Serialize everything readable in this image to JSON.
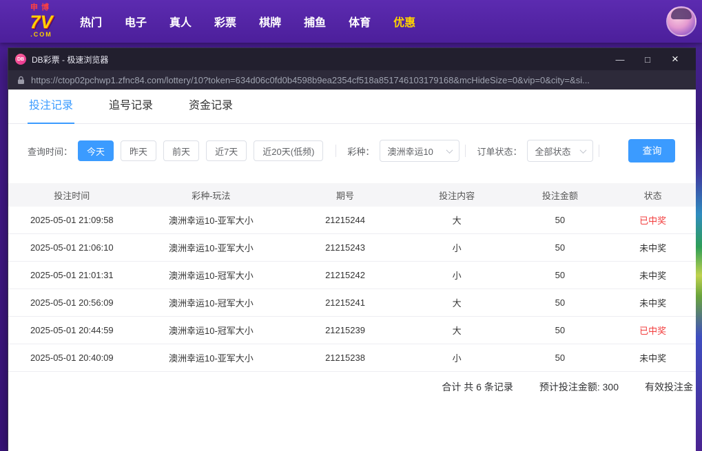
{
  "topbar": {
    "logo": {
      "line1": "申博",
      "line2": "7V",
      "line3": ".COM"
    },
    "nav": [
      {
        "label": "热门"
      },
      {
        "label": "电子"
      },
      {
        "label": "真人"
      },
      {
        "label": "彩票"
      },
      {
        "label": "棋牌"
      },
      {
        "label": "捕鱼"
      },
      {
        "label": "体育"
      },
      {
        "label": "优惠",
        "highlight": true
      }
    ]
  },
  "browser": {
    "badge": "DB",
    "title": "DB彩票 - 极速浏览器",
    "url": "https://ctop02pchwp1.zfnc84.com/lottery/10?token=634d06c0fd0b4598b9ea2354cf518a851746103179168&mcHideSize=0&vip=0&city=&si...",
    "controls": {
      "minimize": "—",
      "maximize": "□",
      "close": "×"
    }
  },
  "tabs": [
    {
      "label": "投注记录",
      "active": true
    },
    {
      "label": "追号记录"
    },
    {
      "label": "资金记录"
    }
  ],
  "filters": {
    "time_label": "查询时间：",
    "time_options": [
      {
        "label": "今天",
        "active": true
      },
      {
        "label": "昨天"
      },
      {
        "label": "前天"
      },
      {
        "label": "近7天"
      },
      {
        "label": "近20天(低频)"
      }
    ],
    "lottery_label": "彩种：",
    "lottery_value": "澳洲幸运10",
    "status_label": "订单状态：",
    "status_value": "全部状态",
    "search_button": "查询"
  },
  "table": {
    "headers": [
      "投注时间",
      "彩种-玩法",
      "期号",
      "投注内容",
      "投注金额",
      "状态"
    ],
    "rows": [
      {
        "time": "2025-05-01 21:09:58",
        "game": "澳洲幸运10-亚军大小",
        "issue": "21215244",
        "content": "大",
        "amount": "50",
        "status": "已中奖",
        "win": true
      },
      {
        "time": "2025-05-01 21:06:10",
        "game": "澳洲幸运10-亚军大小",
        "issue": "21215243",
        "content": "小",
        "amount": "50",
        "status": "未中奖",
        "win": false
      },
      {
        "time": "2025-05-01 21:01:31",
        "game": "澳洲幸运10-冠军大小",
        "issue": "21215242",
        "content": "小",
        "amount": "50",
        "status": "未中奖",
        "win": false
      },
      {
        "time": "2025-05-01 20:56:09",
        "game": "澳洲幸运10-冠军大小",
        "issue": "21215241",
        "content": "大",
        "amount": "50",
        "status": "未中奖",
        "win": false
      },
      {
        "time": "2025-05-01 20:44:59",
        "game": "澳洲幸运10-冠军大小",
        "issue": "21215239",
        "content": "大",
        "amount": "50",
        "status": "已中奖",
        "win": true
      },
      {
        "time": "2025-05-01 20:40:09",
        "game": "澳洲幸运10-亚军大小",
        "issue": "21215238",
        "content": "小",
        "amount": "50",
        "status": "未中奖",
        "win": false
      }
    ]
  },
  "footer": {
    "total": "合计 共 6 条记录",
    "expected": "预计投注金额: 300",
    "effective": "有效投注金"
  },
  "colors": {
    "accent": "#3b9bff",
    "win_red": "#f23c3c",
    "topbar_purple": "#5c2bb0",
    "highlight_yellow": "#ffd200"
  }
}
